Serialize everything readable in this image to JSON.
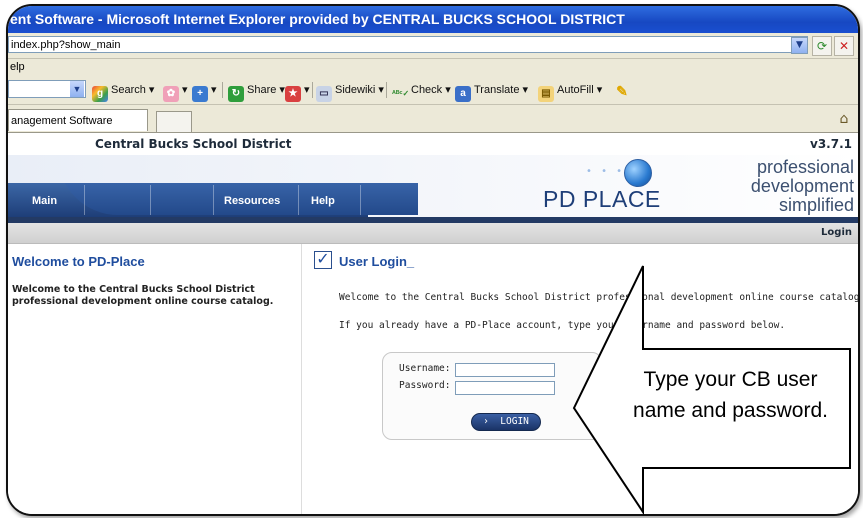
{
  "browser": {
    "title": "ent Software - Microsoft Internet Explorer provided by CENTRAL BUCKS SCHOOL DISTRICT",
    "address": "index.php?show_main",
    "menu": "elp",
    "toolbar": {
      "search": "Search",
      "share": "Share",
      "sidewiki": "Sidewiki",
      "check": "Check",
      "translate": "Translate",
      "autofill": "AutoFill"
    },
    "tab_label": "anagement Software"
  },
  "site": {
    "district": "Central Bucks School District",
    "version": "v3.7.1",
    "nav": [
      "Main",
      "Resources",
      "Help"
    ],
    "logo": "PD PLACE",
    "tagline": [
      "professional",
      "development",
      "simplified"
    ],
    "login_link": "Login"
  },
  "sidebar": {
    "title": "Welcome to PD-Place",
    "text": "Welcome to the Central Bucks School District professional development online course catalog."
  },
  "main": {
    "title": "User Login_",
    "line1": "Welcome to the Central Bucks School District professional development online course catalog.",
    "line2": "If you already have a PD-Place account, type your username and password below.",
    "username_label": "Username:",
    "password_label": "Password:",
    "login_button": "LOGIN"
  },
  "callout": {
    "text": "Type your CB user name and password."
  }
}
